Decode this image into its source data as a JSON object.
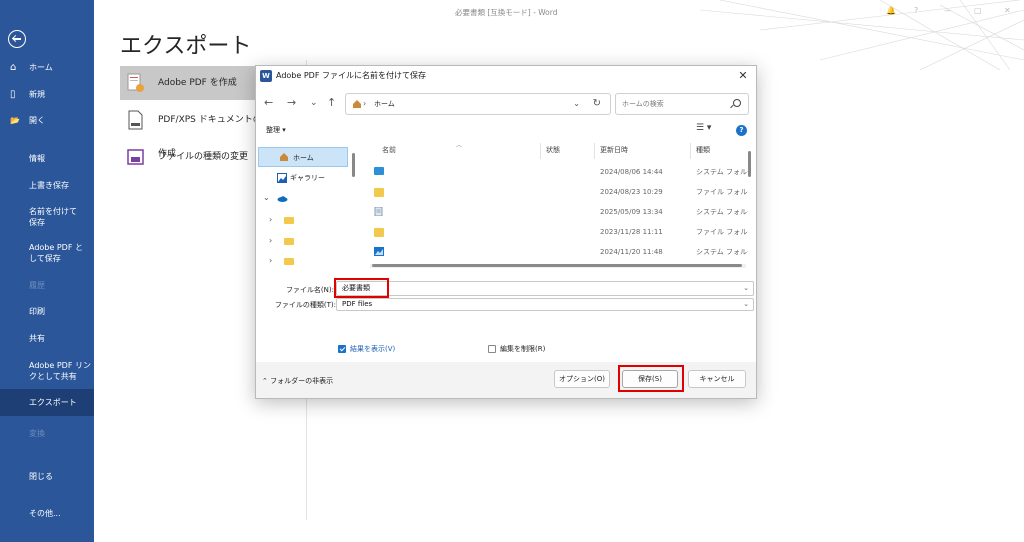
{
  "window": {
    "title": "必要書類 [互換モード] - Word",
    "controls": [
      "🔔",
      "?",
      "—",
      "▢",
      "✕"
    ]
  },
  "sidebar": {
    "back_icon": "back-arrow-icon",
    "items": [
      {
        "label": "ホーム",
        "icon": "⌂",
        "state": "normal"
      },
      {
        "label": "新規",
        "icon": "▯",
        "state": "normal"
      },
      {
        "label": "開く",
        "icon": "📂",
        "state": "normal"
      },
      {
        "label": "情報",
        "state": "normal"
      },
      {
        "label": "上書き保存",
        "state": "normal"
      },
      {
        "label": "名前を付けて保存",
        "state": "normal"
      },
      {
        "label": "Adobe PDF として保存",
        "state": "normal"
      },
      {
        "label": "履歴",
        "state": "disabled"
      },
      {
        "label": "印刷",
        "state": "normal"
      },
      {
        "label": "共有",
        "state": "normal"
      },
      {
        "label": "Adobe PDF リンクとして共有",
        "state": "normal"
      },
      {
        "label": "エクスポート",
        "state": "active"
      },
      {
        "label": "変換",
        "state": "disabled"
      },
      {
        "label": "閉じる",
        "state": "normal"
      },
      {
        "label": "その他...",
        "state": "normal"
      }
    ]
  },
  "export": {
    "title": "エクスポート",
    "options": [
      {
        "label": "Adobe PDF を作成",
        "selected": true
      },
      {
        "label": "PDF/XPS ドキュメントの作成",
        "selected": false
      },
      {
        "label": "ファイルの種類の変更",
        "selected": false
      }
    ]
  },
  "dialog": {
    "title": "Adobe PDF ファイルに名前を付けて保存",
    "close": "✕",
    "nav": {
      "back": "←",
      "forward": "→",
      "recent": "⌄",
      "up": "↑"
    },
    "address": {
      "separator": "›",
      "location": "ホーム",
      "dropdown": "⌄",
      "refresh": "↻"
    },
    "search_placeholder": "ホームの検索",
    "organize": "整理 ▾",
    "view": "☰ ▾",
    "help": "?",
    "nav_pane": {
      "home": "ホーム",
      "gallery": "ギャラリー",
      "chevron": "›",
      "expanded": "⌄"
    },
    "columns": {
      "name": "名前",
      "status": "状態",
      "modified": "更新日時",
      "type": "種類"
    },
    "files": [
      {
        "date": "2024/08/06 14:44",
        "type": "システム フォルダー",
        "icon": "desktop-folder-icon"
      },
      {
        "date": "2024/08/23 10:29",
        "type": "ファイル フォルダー",
        "icon": "folder-icon"
      },
      {
        "date": "2025/05/09 13:34",
        "type": "システム フォルダー",
        "icon": "document-folder-icon"
      },
      {
        "date": "2023/11/28 11:11",
        "type": "ファイル フォルダー",
        "icon": "folder-icon"
      },
      {
        "date": "2024/11/20 11:48",
        "type": "システム フォルダー",
        "icon": "pictures-folder-icon"
      }
    ],
    "filename_label": "ファイル名(N):",
    "filename_value": "必要書類",
    "filetype_label": "ファイルの種類(T):",
    "filetype_value": "PDF files",
    "view_result_label": "結果を表示(V)",
    "view_result_checked": true,
    "restrict_edit_label": "編集を制限(R)",
    "restrict_edit_checked": false,
    "hide_folders": "フォルダーの非表示",
    "hide_folders_icon": "⌃",
    "options_button": "オプション(O)",
    "save_button": "保存(S)",
    "cancel_button": "キャンセル"
  },
  "colors": {
    "sidebar": "#2b579a",
    "sidebar_active": "#1d3f75",
    "highlight": "#e00000",
    "accent": "#1a73c8"
  }
}
